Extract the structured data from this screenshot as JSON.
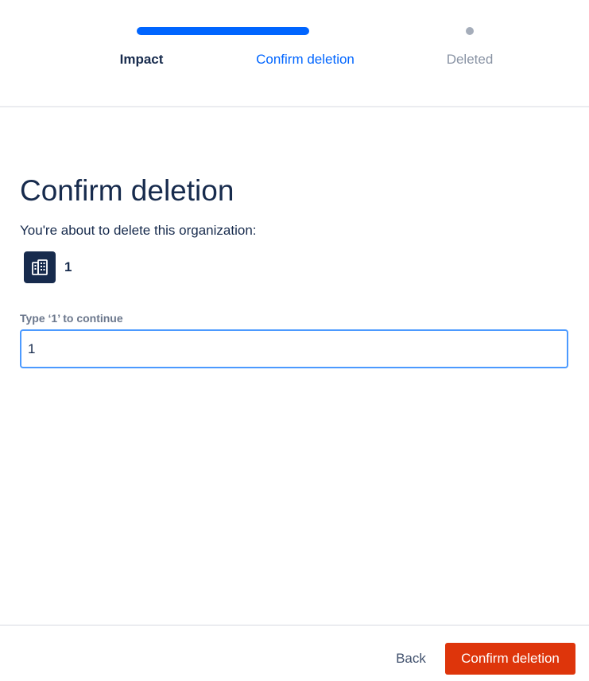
{
  "progress": {
    "steps": [
      {
        "label": "Impact",
        "state": "completed"
      },
      {
        "label": "Confirm deletion",
        "state": "current"
      },
      {
        "label": "Deleted",
        "state": "upcoming"
      }
    ]
  },
  "main": {
    "title": "Confirm deletion",
    "intro": "You're about to delete this organization:",
    "organization": {
      "icon": "building-icon",
      "name": "1"
    },
    "confirm_field": {
      "label": "Type ‘1’ to continue",
      "value": "1"
    }
  },
  "footer": {
    "back_label": "Back",
    "confirm_label": "Confirm deletion"
  },
  "colors": {
    "accent": "#0065ff",
    "danger": "#de350b",
    "text": "#172b4d",
    "muted": "#8993a4",
    "focus": "#4c9aff"
  }
}
